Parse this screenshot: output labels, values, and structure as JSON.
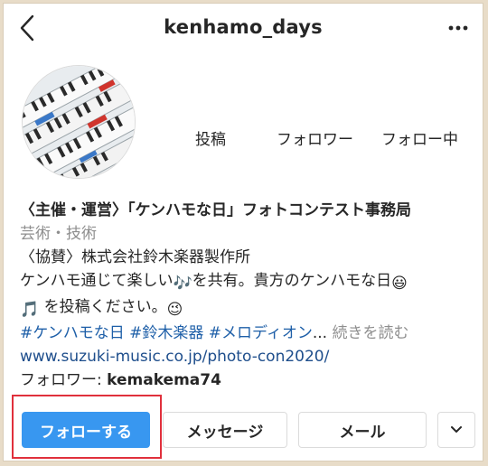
{
  "header": {
    "back_icon": "chevron-left-icon",
    "username": "kenhamo_days",
    "more_icon": "more-horizontal-icon"
  },
  "stats": {
    "posts_label": "投稿",
    "followers_label": "フォロワー",
    "following_label": "フォロー中"
  },
  "bio": {
    "name": "〈主催・運営〉「ケンハモな日」フォトコンテスト事務局",
    "category": "芸術・技術",
    "line1": "〈協賛〉株式会社鈴木楽器製作所",
    "line2_text_a": "ケンハモ通じて楽しい",
    "line2_emoji_a": "🎶",
    "line2_text_b": "を共有。貴方のケンハモな日",
    "line2_emoji_b": "😃",
    "line3_emoji_a": "🎵",
    "line3_text": " を投稿ください。",
    "line3_emoji_b": "😉",
    "hashtag1": "#ケンハモな日",
    "hashtag2": "#鈴木楽器",
    "hashtag3": "#メロディオン",
    "ellipsis": "...",
    "read_more": "続きを読む",
    "website": "www.suzuki-music.co.jp/photo-con2020/",
    "followed_by_label": "フォロワー: ",
    "followed_by_user": "kemakema74"
  },
  "actions": {
    "follow": "フォローする",
    "message": "メッセージ",
    "mail": "メール",
    "dropdown_icon": "chevron-down-icon"
  },
  "colors": {
    "accent": "#3897f0",
    "link": "#1e4e8c",
    "hashtag": "#1e5fa8",
    "muted": "#8e8e8e",
    "highlight": "#e0303c"
  }
}
